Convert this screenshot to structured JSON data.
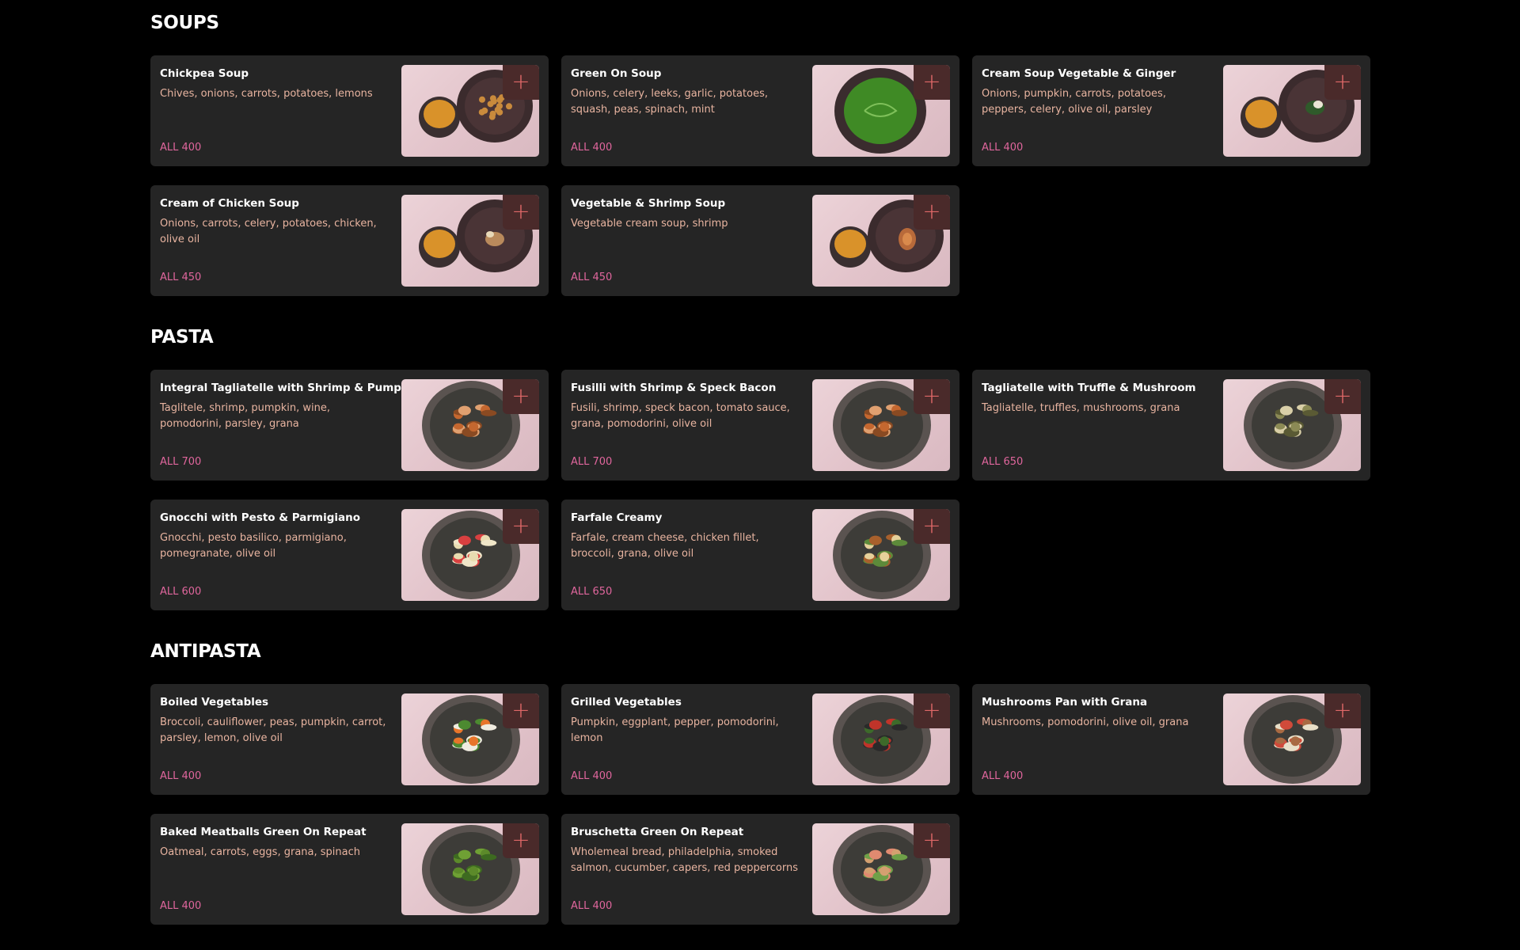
{
  "colors": {
    "page_background": "#000000",
    "card_background": "#252525",
    "item_name": "#ffffff",
    "description": "#e8b4a0",
    "price": "#e0669d",
    "add_button_bg": "#4a2a2a",
    "add_button_icon": "#e06868"
  },
  "sections": [
    {
      "title": "SOUPS",
      "items": [
        {
          "name": "Chickpea Soup",
          "description": "Chives, onions, carrots, potatoes, lemons",
          "price": "ALL 400",
          "image": "soup-bowl-with-chickpeas"
        },
        {
          "name": "Green On Soup",
          "description": "Onions, celery, leeks, garlic, potatoes, squash, peas, spinach, mint",
          "price": "ALL 400",
          "image": "green-soup-bowl"
        },
        {
          "name": "Cream Soup Vegetable & Ginger",
          "description": "Onions, pumpkin, carrots, potatoes, peppers, celery, olive oil, parsley",
          "price": "ALL 400",
          "image": "soup-bowl-with-greens"
        },
        {
          "name": "Cream of Chicken Soup",
          "description": "Onions, carrots, celery, potatoes, chicken, olive oil",
          "price": "ALL 450",
          "image": "soup-bowl-with-chicken"
        },
        {
          "name": "Vegetable & Shrimp Soup",
          "description": "Vegetable cream soup, shrimp",
          "price": "ALL 450",
          "image": "soup-bowl-with-shrimp"
        }
      ]
    },
    {
      "title": "PASTA",
      "items": [
        {
          "name": "Integral Tagliatelle with Shrimp & Pumpkin",
          "description": "Taglitele, shrimp, pumpkin, wine, pomodorini, parsley, grana",
          "price": "ALL 700",
          "image": "shrimp-pasta-plate"
        },
        {
          "name": "Fusilli with Shrimp & Speck Bacon",
          "description": "Fusili, shrimp, speck bacon, tomato sauce, grana, pomodorini, olive oil",
          "price": "ALL 700",
          "image": "shrimp-pasta-plate"
        },
        {
          "name": "Tagliatelle with Truffle & Mushroom",
          "description": "Tagliatelle, truffles, mushrooms, grana",
          "price": "ALL 650",
          "image": "truffle-pasta-plate"
        },
        {
          "name": "Gnocchi with Pesto & Parmigiano",
          "description": "Gnocchi, pesto basilico, parmigiano, pomegranate, olive oil",
          "price": "ALL 600",
          "image": "gnocchi-plate"
        },
        {
          "name": "Farfale Creamy",
          "description": "Farfale, cream cheese, chicken fillet, broccoli, grana, olive oil",
          "price": "ALL 650",
          "image": "farfalle-plate"
        }
      ]
    },
    {
      "title": "ANTIPASTA",
      "items": [
        {
          "name": "Boiled Vegetables",
          "description": "Broccoli, cauliflower, peas, pumpkin, carrot, parsley, lemon, olive oil",
          "price": "ALL 400",
          "image": "boiled-vegetables-plate"
        },
        {
          "name": "Grilled Vegetables",
          "description": "Pumpkin, eggplant, pepper, pomodorini, lemon",
          "price": "ALL 400",
          "image": "grilled-vegetables-plate"
        },
        {
          "name": "Mushrooms Pan with Grana",
          "description": "Mushrooms, pomodorini, olive oil, grana",
          "price": "ALL 400",
          "image": "mushrooms-plate"
        },
        {
          "name": "Baked Meatballs Green On Repeat",
          "description": "Oatmeal, carrots, eggs, grana, spinach",
          "price": "ALL 400",
          "image": "green-meatballs-plate"
        },
        {
          "name": "Bruschetta Green On Repeat",
          "description": "Wholemeal bread, philadelphia, smoked salmon, cucumber, capers, red peppercorns",
          "price": "ALL 400",
          "image": "bruschetta-plate"
        }
      ]
    }
  ],
  "add_button_icon": "plus-icon",
  "add_button_symbol": "+"
}
